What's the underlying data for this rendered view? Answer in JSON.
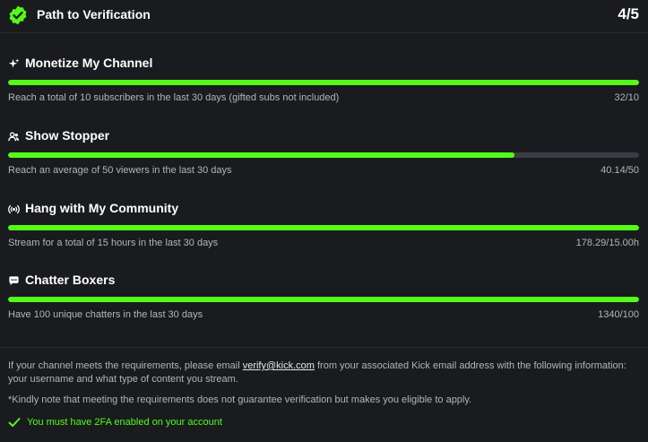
{
  "header": {
    "title": "Path to Verification",
    "count": "4/5",
    "badge_icon": "verified-badge-icon"
  },
  "requirements": [
    {
      "icon": "sparkle-icon",
      "title": "Monetize My Channel",
      "description": "Reach a total of 10 subscribers in the last 30 days (gifted subs not included)",
      "value": "32/10",
      "progress": 1.0
    },
    {
      "icon": "users-icon",
      "title": "Show Stopper",
      "description": "Reach an average of 50 viewers in the last 30 days",
      "value": "40.14/50",
      "progress": 0.8028
    },
    {
      "icon": "broadcast-icon",
      "title": "Hang with My Community",
      "description": "Stream for a total of 15 hours in the last 30 days",
      "value": "178.29/15.00h",
      "progress": 1.0
    },
    {
      "icon": "chat-bubble-icon",
      "title": "Chatter Boxers",
      "description": "Have 100 unique chatters in the last 30 days",
      "value": "1340/100",
      "progress": 1.0
    }
  ],
  "info": {
    "before_email": "If your channel meets the requirements, please email ",
    "email": "verify@kick.com",
    "after_email": " from your associated Kick email address with the following information: your username and what type of content you stream.",
    "note": "*Kindly note that meeting the requirements does not guarantee verification but makes you eligible to apply.",
    "twofa": "You must have 2FA enabled on your account"
  },
  "colors": {
    "accent": "#53fc18",
    "background": "#191b1f",
    "track": "#3a3d43",
    "muted_text": "#b1b5bb"
  }
}
